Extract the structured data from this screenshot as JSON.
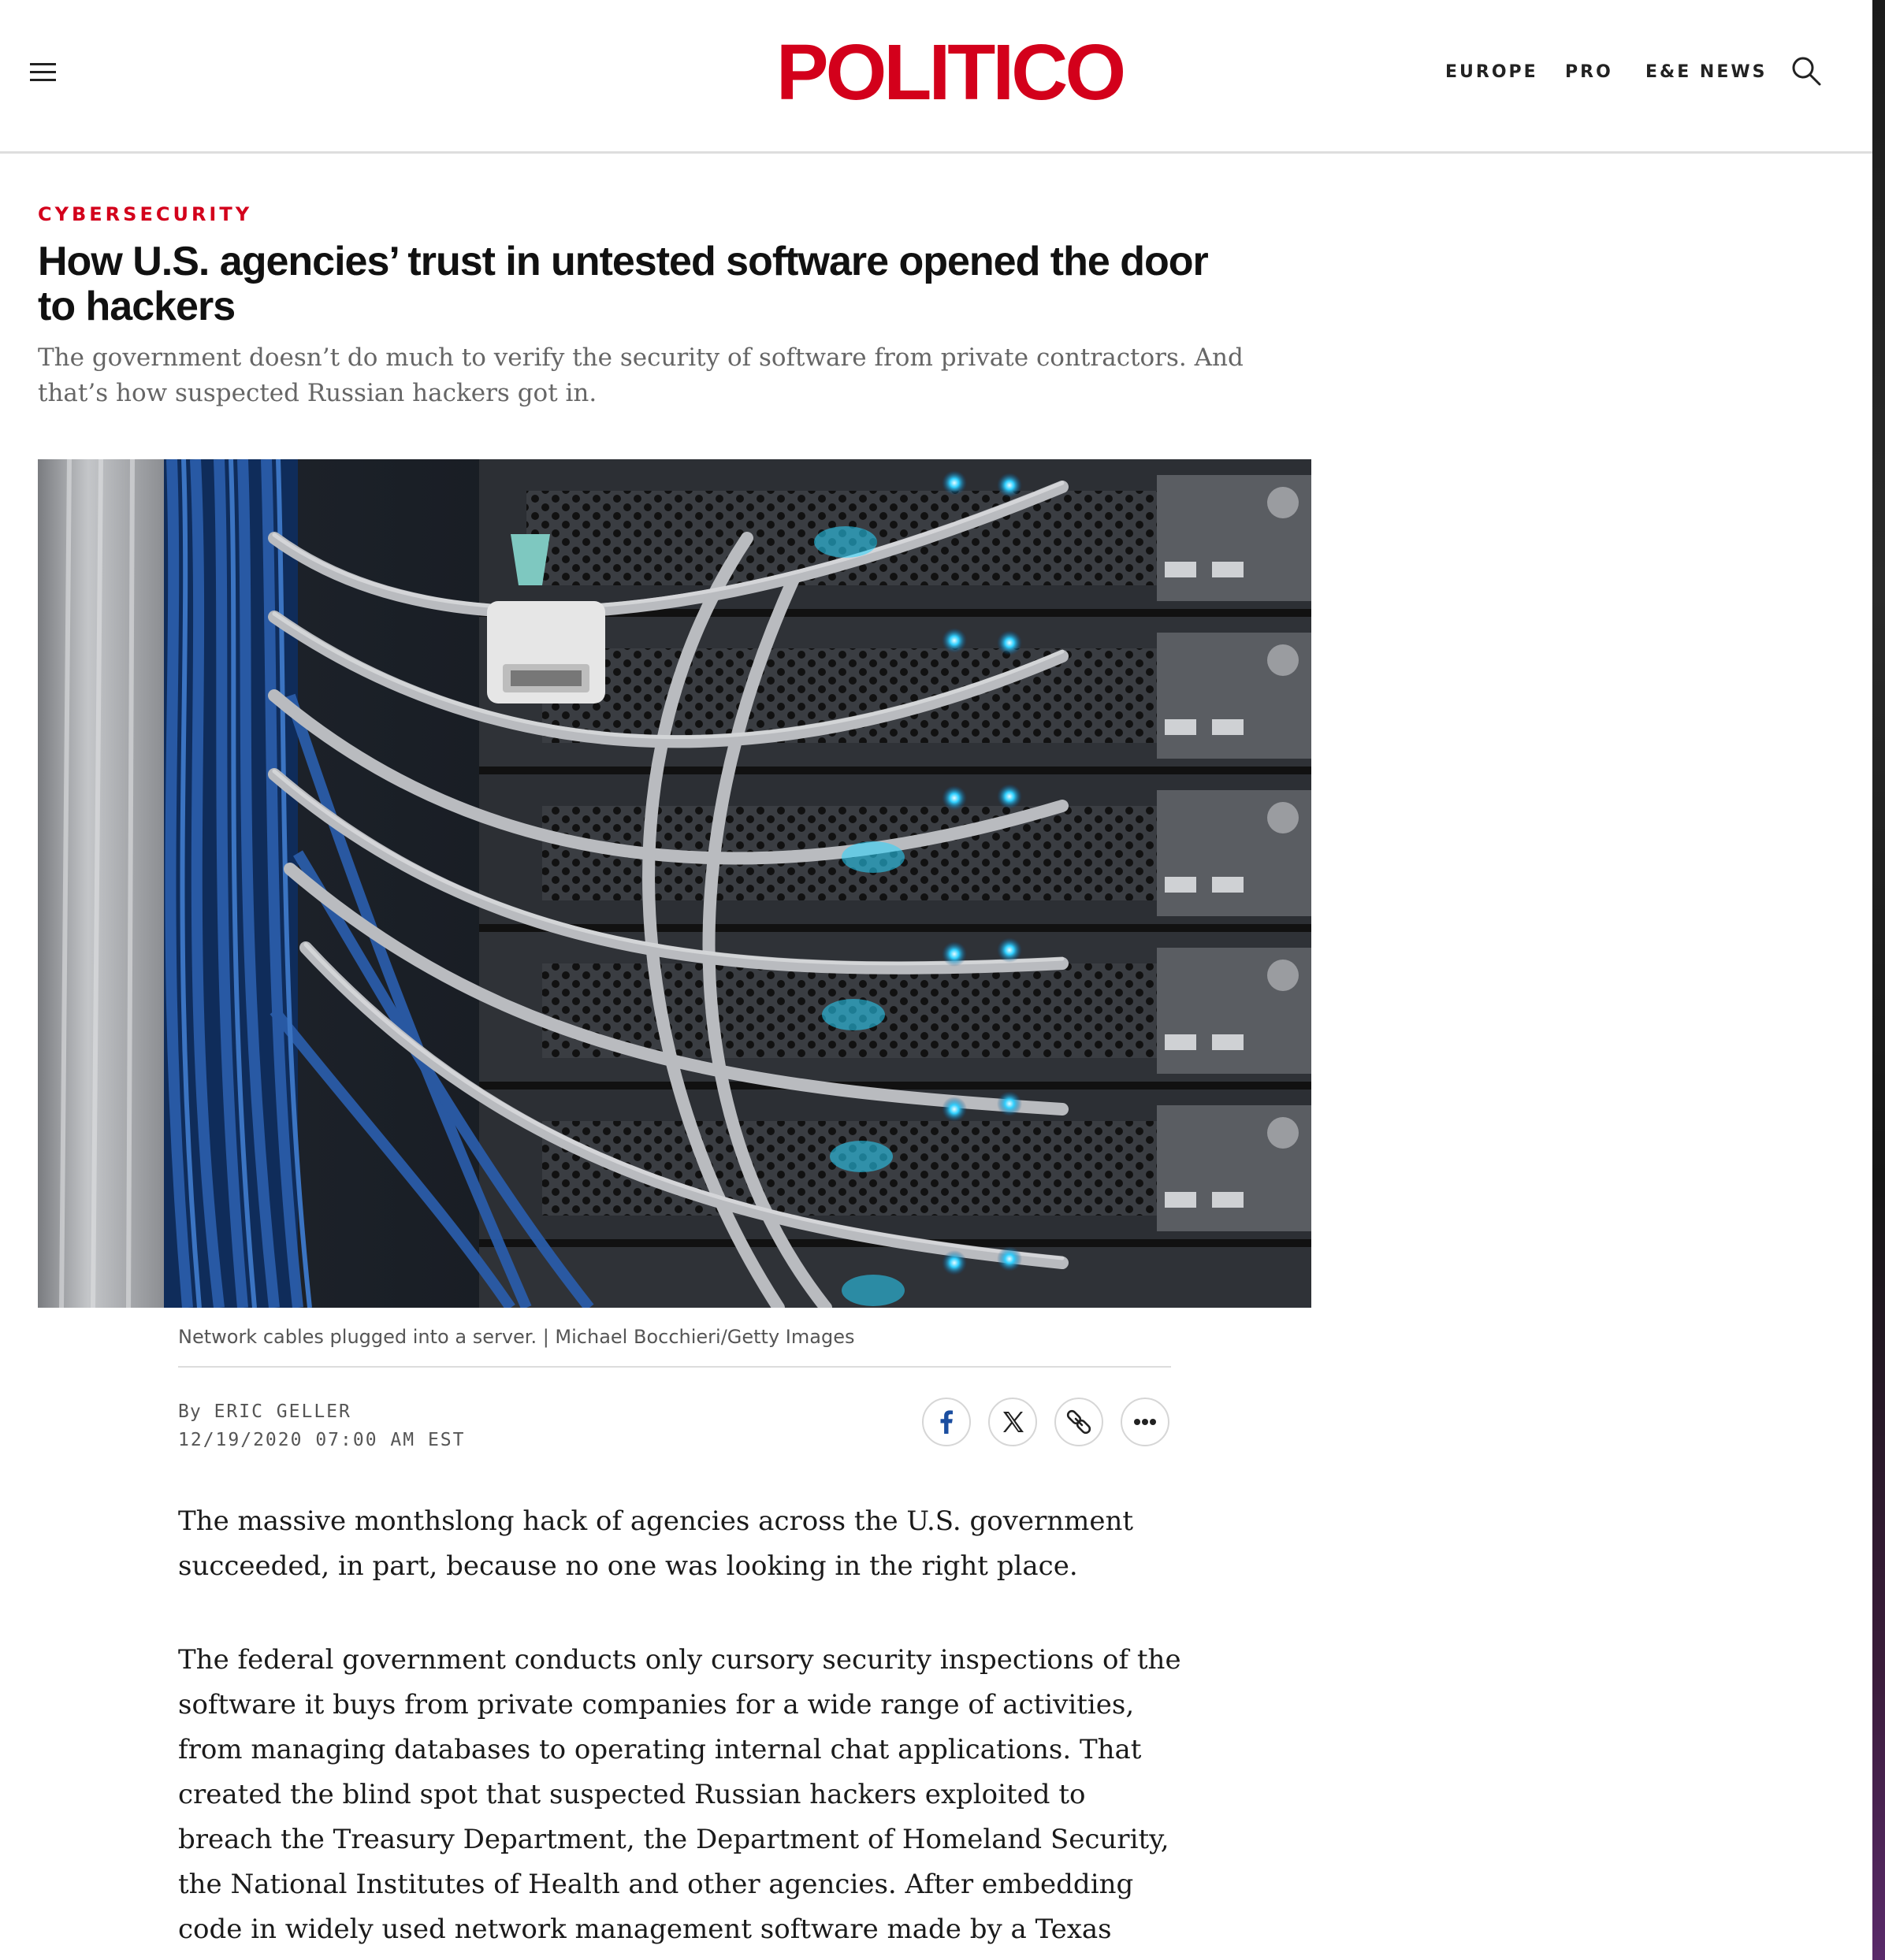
{
  "header": {
    "logo": "POLITICO",
    "nav": [
      "EUROPE",
      "PRO",
      "E&E NEWS"
    ],
    "menu_icon": "hamburger-menu-icon",
    "search_icon": "search-icon",
    "logo_color": "#d3001b"
  },
  "article": {
    "kicker": "CYBERSECURITY",
    "headline": "How U.S. agencies’ trust in untested software opened the door to hackers",
    "dek": "The government doesn’t do much to verify the security of software from private contractors. And that’s how suspected Russian hackers got in.",
    "image_caption": "Network cables plugged into a server. | Michael Bocchieri/Getty Images",
    "byline_prefix": "By",
    "author": "ERIC GELLER",
    "timestamp": "12/19/2020 07:00 AM EST",
    "share_buttons": [
      "facebook-icon",
      "x-icon",
      "link-icon",
      "more-icon"
    ],
    "paragraphs": [
      "The massive monthslong hack of agencies across the U.S. government succeeded, in part, because no one was looking in the right place.",
      "The federal government conducts only cursory security inspections of the software it buys from private companies for a wide range of activities, from managing databases to operating internal chat applications. That created the blind spot that suspected Russian hackers exploited to breach the Treasury Department, the Department of Homeland Security, the National Institutes of Health and other agencies. After embedding code in widely used network management software made by a Texas company called SolarWinds, all they"
    ]
  }
}
